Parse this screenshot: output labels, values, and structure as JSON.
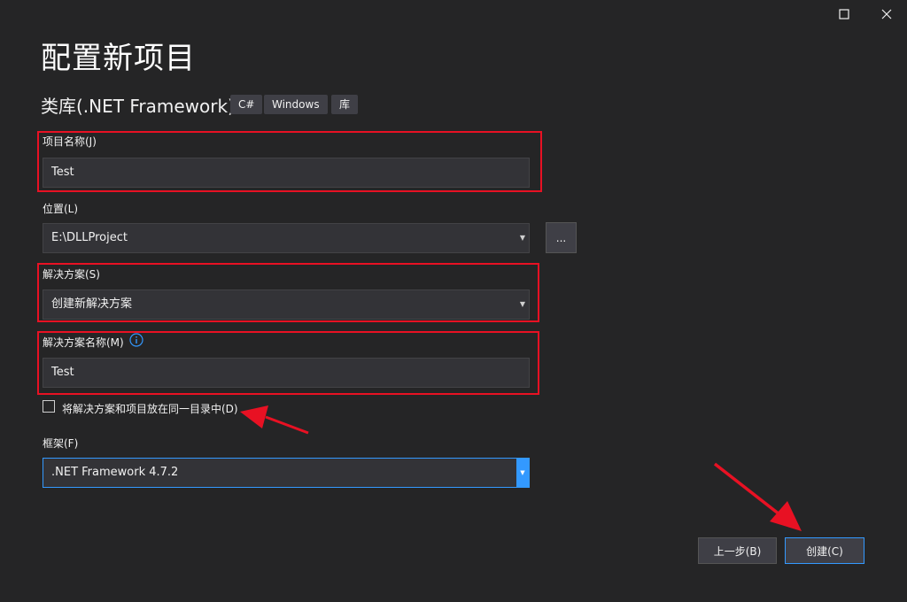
{
  "window": {
    "maximize_icon": "maximize-icon",
    "close_icon": "close-icon"
  },
  "header": {
    "title": "配置新项目",
    "subtitle": "类库(.NET Framework)",
    "tags": [
      "C#",
      "Windows",
      "库"
    ]
  },
  "project_name": {
    "label": "项目名称(J)",
    "value": "Test"
  },
  "location": {
    "label": "位置(L)",
    "value": "E:\\DLLProject",
    "browse_label": "..."
  },
  "solution": {
    "label": "解决方案(S)",
    "value": "创建新解决方案"
  },
  "solution_name": {
    "label": "解决方案名称(M)",
    "value": "Test",
    "info_icon": "info-icon"
  },
  "same_dir": {
    "label": "将解决方案和项目放在同一目录中(D)",
    "checked": false
  },
  "framework": {
    "label": "框架(F)",
    "value": ".NET Framework 4.7.2"
  },
  "footer": {
    "back_label": "上一步(B)",
    "create_label": "创建(C)"
  },
  "colors": {
    "background": "#252526",
    "annotation_red": "#e81123",
    "focus_blue": "#3399ff"
  }
}
